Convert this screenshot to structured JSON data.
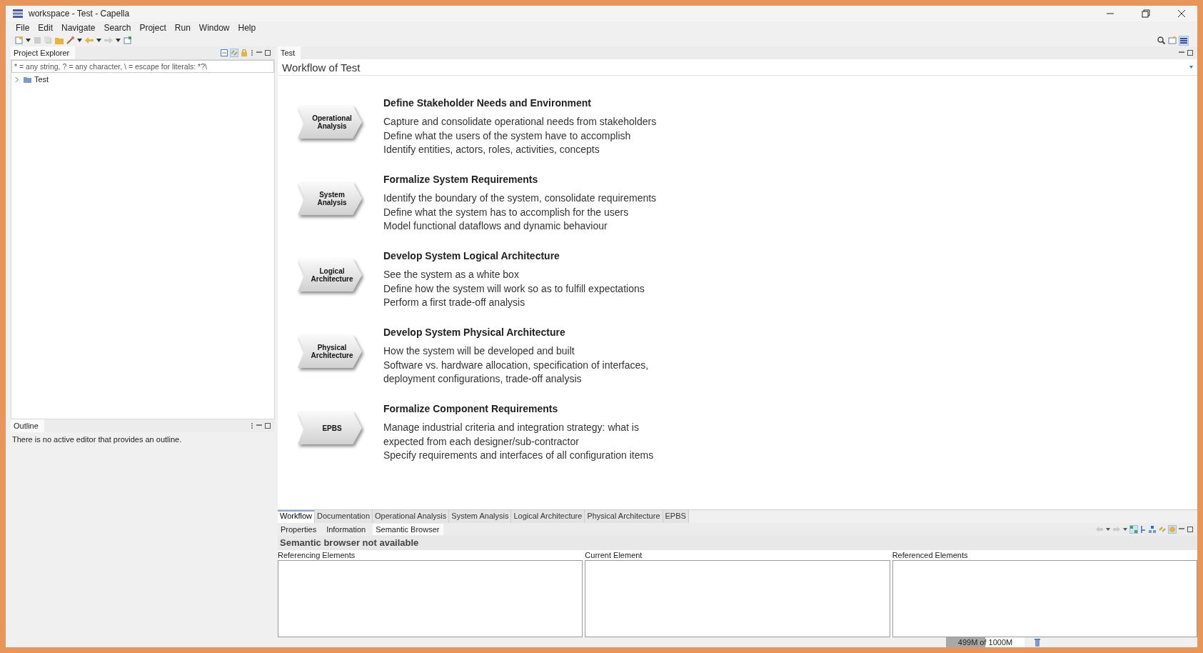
{
  "window": {
    "title": "workspace - Test - Capella"
  },
  "menu": [
    "File",
    "Edit",
    "Navigate",
    "Search",
    "Project",
    "Run",
    "Window",
    "Help"
  ],
  "explorer": {
    "title": "Project Explorer",
    "placeholder": "* = any string, ? = any character, \\ = escape for literals: *?\\",
    "tree": [
      {
        "label": "Test",
        "expanded": false
      }
    ]
  },
  "outline": {
    "title": "Outline",
    "message": "There is no active editor that provides an outline."
  },
  "editor": {
    "tab": "Test",
    "title": "Workflow of Test",
    "stages": [
      {
        "label": "Operational Analysis",
        "heading": "Define Stakeholder Needs and Environment",
        "lines": [
          "Capture and consolidate operational needs from stakeholders",
          "Define what the users of the system have to accomplish",
          "Identify entities, actors, roles, activities, concepts"
        ]
      },
      {
        "label": "System Analysis",
        "heading": "Formalize System Requirements",
        "lines": [
          "Identify the boundary of the system, consolidate requirements",
          "Define what the system has to accomplish for the users",
          "Model functional dataflows and dynamic behaviour"
        ]
      },
      {
        "label": "Logical Architecture",
        "heading": "Develop System Logical Architecture",
        "lines": [
          "See the system as a white box",
          "Define how the system will work so as to fulfill expectations",
          "Perform a first trade-off analysis"
        ]
      },
      {
        "label": "Physical Architecture",
        "heading": "Develop System Physical Architecture",
        "lines": [
          "How the system will be developed and built",
          "Software vs. hardware allocation, specification of interfaces,",
          "deployment configurations, trade-off analysis"
        ]
      },
      {
        "label": "EPBS",
        "heading": "Formalize Component Requirements",
        "lines": [
          "Manage industrial criteria and integration strategy: what is",
          "expected from each designer/sub-contractor",
          "Specify requirements and interfaces of all configuration items"
        ]
      }
    ],
    "pages": [
      {
        "label": "Workflow",
        "selected": true
      },
      {
        "label": "Documentation",
        "selected": false
      },
      {
        "label": "Operational Analysis",
        "selected": false
      },
      {
        "label": "System Analysis",
        "selected": false
      },
      {
        "label": "Logical Architecture",
        "selected": false
      },
      {
        "label": "Physical Architecture",
        "selected": false
      },
      {
        "label": "EPBS",
        "selected": false
      }
    ]
  },
  "bottom": {
    "tabs": [
      {
        "label": "Properties",
        "selected": false
      },
      {
        "label": "Information",
        "selected": false
      },
      {
        "label": "Semantic Browser",
        "selected": true
      }
    ],
    "message": "Semantic browser not available",
    "columns": [
      "Referencing Elements",
      "Current Element",
      "Referenced Elements"
    ]
  },
  "status": {
    "memory": "499M of 1000M",
    "level": 0.5
  }
}
